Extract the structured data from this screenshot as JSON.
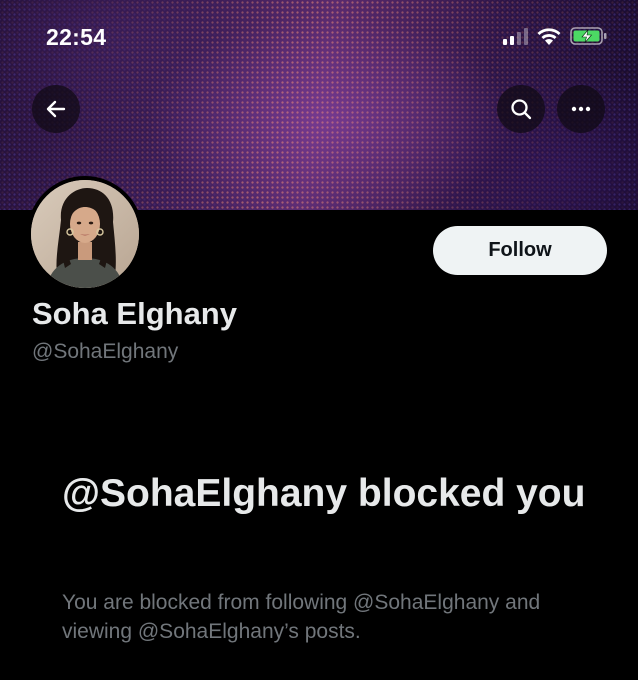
{
  "status_bar": {
    "time": "22:54",
    "icons": [
      "cellular-signal-icon",
      "wifi-icon",
      "battery-charging-icon"
    ]
  },
  "nav": {
    "back_icon": "arrow-left-icon",
    "search_icon": "search-icon",
    "more_icon": "more-horizontal-icon"
  },
  "profile": {
    "display_name": "Soha Elghany",
    "handle": "@SohaElghany",
    "follow_label": "Follow",
    "banner_colors": [
      "#241038",
      "#5a2a6e",
      "#160a2a"
    ]
  },
  "blocked_notice": {
    "title": "@SohaElghany blocked you",
    "message": "You are blocked from following @SohaElghany and viewing @SohaElghany’s posts."
  },
  "colors": {
    "background": "#000000",
    "primary_text": "#e7e9ea",
    "secondary_text": "#71767b",
    "follow_bg": "#eff3f4",
    "battery_charging": "#4cd964"
  }
}
